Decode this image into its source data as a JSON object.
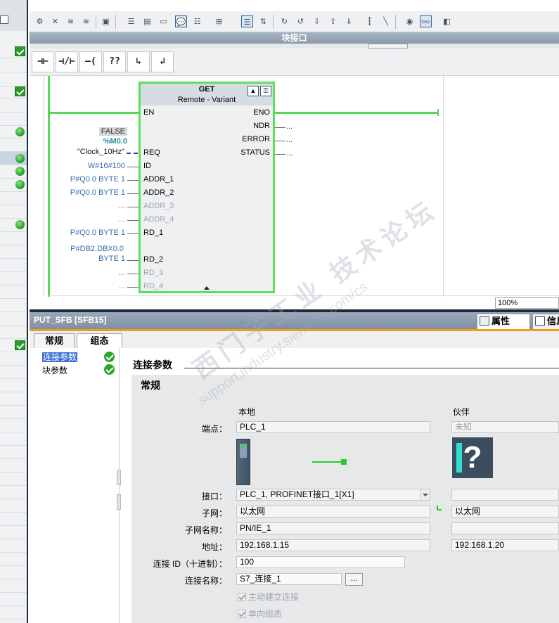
{
  "header": {
    "block_interface_label": "块接口"
  },
  "lad_palette": {
    "items": [
      {
        "name": "normally-open-contact",
        "glyph": "⊣⊢"
      },
      {
        "name": "normally-closed-contact",
        "glyph": "⊣/⊢"
      },
      {
        "name": "output-coil",
        "glyph": "–( )–"
      },
      {
        "name": "empty-box",
        "glyph": "??"
      },
      {
        "name": "open-branch",
        "glyph": "↳"
      },
      {
        "name": "close-branch",
        "glyph": "↲"
      }
    ]
  },
  "function_block": {
    "name": "GET",
    "type_parts": [
      "Remote",
      "-",
      "Variant"
    ],
    "inputs": [
      "EN",
      "REQ",
      "ID",
      "ADDR_1",
      "ADDR_2",
      "ADDR_3",
      "ADDR_4",
      "RD_1",
      "RD_2",
      "RD_3",
      "RD_4"
    ],
    "outputs": [
      "ENO",
      "NDR",
      "ERROR",
      "STATUS"
    ],
    "arguments": {
      "req_false": "FALSE",
      "req_addr": "%M0.0",
      "req_tag": "\"Clock_10Hz\"",
      "id": "W#16#100",
      "addr_1": "P#Q0.0 BYTE 1",
      "addr_2": "P#Q0.0 BYTE 1",
      "addr_3": "...",
      "addr_4": "...",
      "rd_1": "P#Q0.0 BYTE 1",
      "rd_2_line1": "P#DB2.DBX0.0",
      "rd_2_line2": "BYTE 1",
      "rd_3": "...",
      "rd_4": "...",
      "ndr": "...",
      "error": "...",
      "status": "..."
    }
  },
  "zoom": "100%",
  "properties": {
    "object_name": "PUT_SFB [SFB15]",
    "tab_properties": "属性",
    "tab_info": "信息",
    "subtabs": [
      "常规",
      "组态"
    ],
    "nav": [
      "连接参数",
      "块参数"
    ],
    "section_title": "连接参数",
    "general_title": "常规",
    "columns": {
      "local": "本地",
      "partner": "伙伴"
    },
    "rows": {
      "endpoint_label": "端点：",
      "endpoint_local": "PLC_1",
      "endpoint_partner": "未知",
      "interface_label": "接口：",
      "interface_local": "PLC_1, PROFINET接口_1[X1]",
      "interface_partner": "",
      "subnet_label": "子网：",
      "subnet_local": "以太网",
      "subnet_partner": "以太网",
      "subnet_name_label": "子网名称：",
      "subnet_name_local": "PN/IE_1",
      "subnet_name_partner": "",
      "address_label": "地址：",
      "address_local": "192.168.1.15",
      "address_partner": "192.168.1.20",
      "conn_id_label": "连接 ID（十进制）：",
      "conn_id": "100",
      "conn_name_label": "连接名称：",
      "conn_name": "S7_连接_1",
      "browse": "...",
      "active_conn": "主动建立连接",
      "one_way": "单向组态"
    },
    "partner_icon": "?"
  },
  "watermark": {
    "cn": "西门子工业 技术论坛",
    "url": "support.industry.siemens.com/cs"
  },
  "colors": {
    "accent_green": "#56d856",
    "tab_orange": "#f29c1a",
    "link_blue": "#3a6fb0"
  }
}
